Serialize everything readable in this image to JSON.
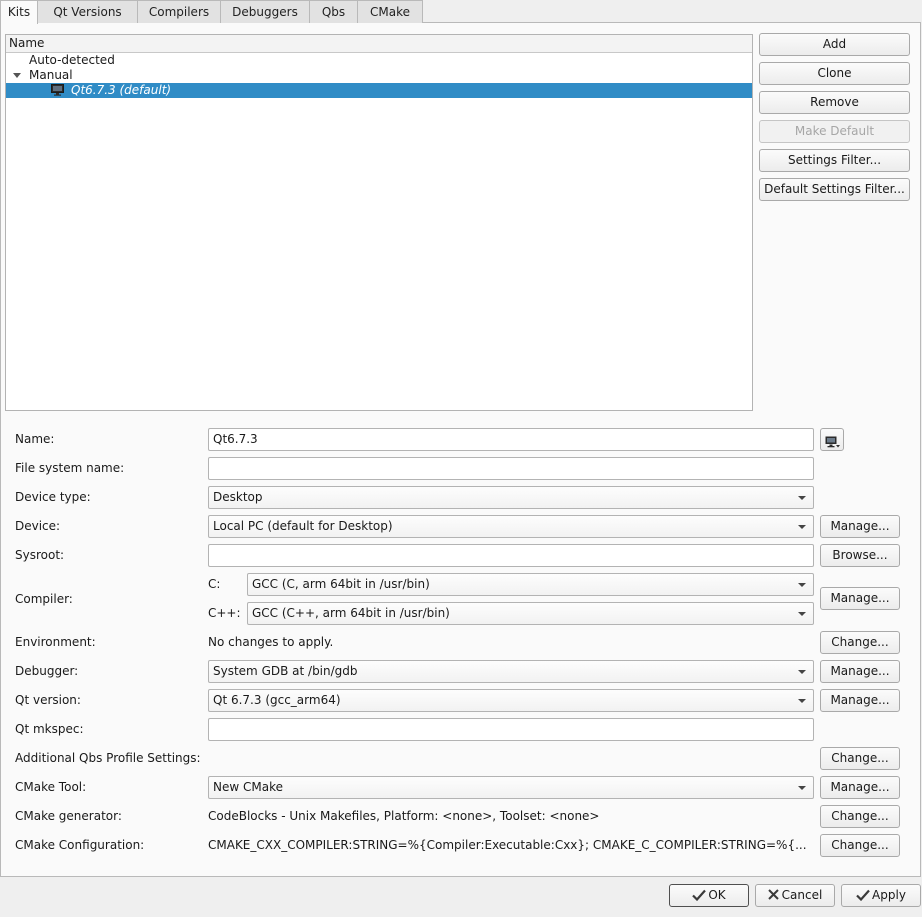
{
  "tabs": [
    {
      "label": "Kits",
      "active": true
    },
    {
      "label": "Qt Versions"
    },
    {
      "label": "Compilers"
    },
    {
      "label": "Debuggers"
    },
    {
      "label": "Qbs"
    },
    {
      "label": "CMake"
    }
  ],
  "tree": {
    "header": "Name",
    "items": [
      "Auto-detected",
      "Manual",
      "Qt6.7.3 (default)"
    ],
    "selected_color": "#308cc6"
  },
  "side_buttons": {
    "add": "Add",
    "clone": "Clone",
    "remove": "Remove",
    "make_default": "Make Default",
    "settings_filter": "Settings Filter...",
    "default_settings_filter": "Default Settings Filter..."
  },
  "form": {
    "name_label": "Name:",
    "name_value": "Qt6.7.3",
    "fs_name_label": "File system name:",
    "fs_name_value": "",
    "device_type_label": "Device type:",
    "device_type_value": "Desktop",
    "device_label": "Device:",
    "device_value": "Local PC (default for Desktop)",
    "sysroot_label": "Sysroot:",
    "sysroot_value": "",
    "compiler_label": "Compiler:",
    "compiler_c_label": "C:",
    "compiler_c_value": "GCC (C, arm 64bit in /usr/bin)",
    "compiler_cxx_label": "C++:",
    "compiler_cxx_value": "GCC (C++, arm 64bit in /usr/bin)",
    "environment_label": "Environment:",
    "environment_value": "No changes to apply.",
    "debugger_label": "Debugger:",
    "debugger_value": "System GDB at /bin/gdb",
    "qt_version_label": "Qt version:",
    "qt_version_value": "Qt 6.7.3 (gcc_arm64)",
    "qt_mkspec_label": "Qt mkspec:",
    "qt_mkspec_value": "",
    "qbs_label": "Additional Qbs Profile Settings:",
    "cmake_tool_label": "CMake Tool:",
    "cmake_tool_value": "New CMake",
    "cmake_gen_label": "CMake generator:",
    "cmake_gen_value": "CodeBlocks - Unix Makefiles, Platform: <none>, Toolset: <none>",
    "cmake_config_label": "CMake Configuration:",
    "cmake_config_value": "CMAKE_CXX_COMPILER:STRING=%{Compiler:Executable:Cxx}; CMAKE_C_COMPILER:STRING=%{..."
  },
  "row_buttons": {
    "manage": "Manage...",
    "browse": "Browse...",
    "change": "Change..."
  },
  "footer": {
    "ok": "OK",
    "cancel": "Cancel",
    "apply": "Apply"
  }
}
